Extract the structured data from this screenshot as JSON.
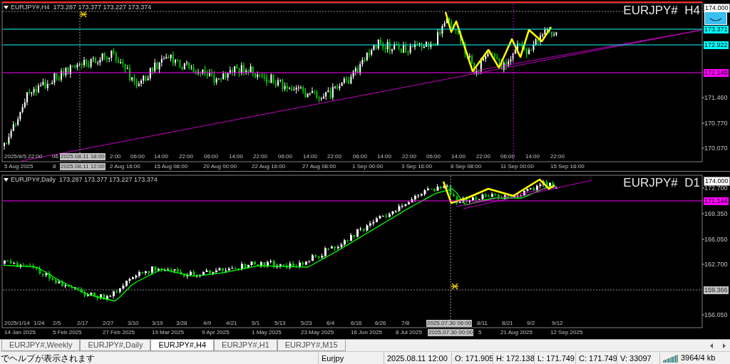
{
  "charts": [
    {
      "header": "EURJPY#,H4  173.287 173.377 173.227 173.374",
      "symbol": "EURJPY#  H4",
      "price_axis": [
        {
          "text": "174.000",
          "kind": "current"
        },
        {
          "text": "173.371",
          "kind": "line",
          "color": "#00ffff"
        },
        {
          "text": "172.922",
          "kind": "line",
          "color": "#00ffff"
        },
        {
          "text": "172.140",
          "kind": "line",
          "color": "#ff00ff"
        },
        {
          "text": "171.460",
          "kind": "tick"
        },
        {
          "text": "170.770",
          "kind": "tick"
        },
        {
          "text": "170.070",
          "kind": "tick"
        }
      ],
      "overlay_times": [
        {
          "text": "2025/8/5 22:00",
          "kind": "tick"
        },
        {
          "text": "06",
          "kind": "tick"
        },
        {
          "text": "2025.08.11 18:00",
          "kind": "crosshair"
        },
        {
          "text": "2:00",
          "kind": "tick"
        },
        {
          "text": "06:00",
          "kind": "tick"
        },
        {
          "text": "14:00",
          "kind": "tick"
        },
        {
          "text": "22:00",
          "kind": "tick"
        },
        {
          "text": "06:00",
          "kind": "tick"
        },
        {
          "text": "14:00",
          "kind": "tick"
        },
        {
          "text": "22:00",
          "kind": "tick"
        },
        {
          "text": "06:00",
          "kind": "tick"
        },
        {
          "text": "14:00",
          "kind": "tick"
        },
        {
          "text": "22:00",
          "kind": "tick"
        },
        {
          "text": "06:00",
          "kind": "tick"
        },
        {
          "text": "14:00",
          "kind": "tick"
        },
        {
          "text": "22:00",
          "kind": "tick"
        },
        {
          "text": "06:00",
          "kind": "tick"
        },
        {
          "text": "14:00",
          "kind": "tick"
        },
        {
          "text": "22:00",
          "kind": "tick"
        },
        {
          "text": "06:00",
          "kind": "tick"
        },
        {
          "text": "14:00",
          "kind": "tick"
        },
        {
          "text": "22:00",
          "kind": "tick"
        }
      ],
      "time_axis": [
        {
          "text": "5 Aug 2025",
          "kind": "tick"
        },
        {
          "text": "8",
          "kind": "tick"
        },
        {
          "text": "2025.08.11 12:00",
          "kind": "crosshair"
        },
        {
          "text": "2 Aug 16:00",
          "kind": "tick"
        },
        {
          "text": "15 Aug 08:00",
          "kind": "tick"
        },
        {
          "text": "20 Aug 00:00",
          "kind": "tick"
        },
        {
          "text": "22 Aug 16:00",
          "kind": "tick"
        },
        {
          "text": "27 Aug 08:00",
          "kind": "tick"
        },
        {
          "text": "1 Sep 00:00",
          "kind": "tick"
        },
        {
          "text": "3 Sep 16:00",
          "kind": "tick"
        },
        {
          "text": "8 Sep 08:00",
          "kind": "tick"
        },
        {
          "text": "11 Sep 00:00",
          "kind": "tick"
        },
        {
          "text": "15 Sep 16:00",
          "kind": "tick"
        }
      ]
    },
    {
      "header": "EURJPY#,Daily  173.287 173.377 173.227 173.374",
      "symbol": "EURJPY#  D1",
      "price_axis": [
        {
          "text": "174.000",
          "kind": "current"
        },
        {
          "text": "172.700",
          "kind": "tick"
        },
        {
          "text": "171.144",
          "kind": "line",
          "color": "#ff00ff"
        },
        {
          "text": "169.350",
          "kind": "tick"
        },
        {
          "text": "166.050",
          "kind": "tick"
        },
        {
          "text": "162.700",
          "kind": "tick"
        },
        {
          "text": "159.366",
          "kind": "crosshair"
        },
        {
          "text": "156.050",
          "kind": "tick"
        }
      ],
      "overlay_times": [
        {
          "text": "2025/1/14",
          "kind": "tick"
        },
        {
          "text": "1/24",
          "kind": "tick"
        },
        {
          "text": "2/5",
          "kind": "tick"
        },
        {
          "text": "2/17",
          "kind": "tick"
        },
        {
          "text": "2/27",
          "kind": "tick"
        },
        {
          "text": "3/10",
          "kind": "tick"
        },
        {
          "text": "3/19",
          "kind": "tick"
        },
        {
          "text": "3/28",
          "kind": "tick"
        },
        {
          "text": "4/9",
          "kind": "tick"
        },
        {
          "text": "4/21",
          "kind": "tick"
        },
        {
          "text": "5/1",
          "kind": "tick"
        },
        {
          "text": "5/13",
          "kind": "tick"
        },
        {
          "text": "5/23",
          "kind": "tick"
        },
        {
          "text": "6/4",
          "kind": "tick"
        },
        {
          "text": "6/16",
          "kind": "tick"
        },
        {
          "text": "6/26",
          "kind": "tick"
        },
        {
          "text": "7/8",
          "kind": "tick"
        },
        {
          "text": "2025.07.30 06:00",
          "kind": "crosshair"
        },
        {
          "text": "8/11",
          "kind": "tick"
        },
        {
          "text": "8/21",
          "kind": "tick"
        },
        {
          "text": "9/2",
          "kind": "tick"
        },
        {
          "text": "9/12",
          "kind": "tick"
        }
      ],
      "time_axis": [
        {
          "text": "14 Jan 2025",
          "kind": "tick"
        },
        {
          "text": "5 Feb 2025",
          "kind": "tick"
        },
        {
          "text": "27 Feb 2025",
          "kind": "tick"
        },
        {
          "text": "19 Mar 2025",
          "kind": "tick"
        },
        {
          "text": "9 Apr 2025",
          "kind": "tick"
        },
        {
          "text": "1 May 2025",
          "kind": "tick"
        },
        {
          "text": "23 May 2025",
          "kind": "tick"
        },
        {
          "text": "16 Jun 2025",
          "kind": "tick"
        },
        {
          "text": "8 Jul 2025",
          "kind": "tick"
        },
        {
          "text": "2025.07.30 00:00",
          "kind": "crosshair"
        },
        {
          "text": "5",
          "kind": "tick"
        },
        {
          "text": "21 Aug 2025",
          "kind": "tick"
        },
        {
          "text": "12 Sep 2025",
          "kind": "tick"
        }
      ]
    }
  ],
  "tabs": [
    {
      "label": "EURJPY#,Weekly",
      "selected": false
    },
    {
      "label": "EURJPY#,Daily",
      "selected": false
    },
    {
      "label": "EURJPY#,H4",
      "selected": true
    },
    {
      "label": "EURJPY#,H1",
      "selected": false
    },
    {
      "label": "EURJPY#,M15",
      "selected": false
    }
  ],
  "status_bar": {
    "help": "でヘルプが表示されます",
    "fields": [
      "Eurjpy",
      "2025.08.11 12:00",
      "O: 171.905",
      "H: 172.138",
      "L: 171.749",
      "C: 171.749",
      "V: 33097"
    ],
    "traffic": "3964/4 kb"
  }
}
